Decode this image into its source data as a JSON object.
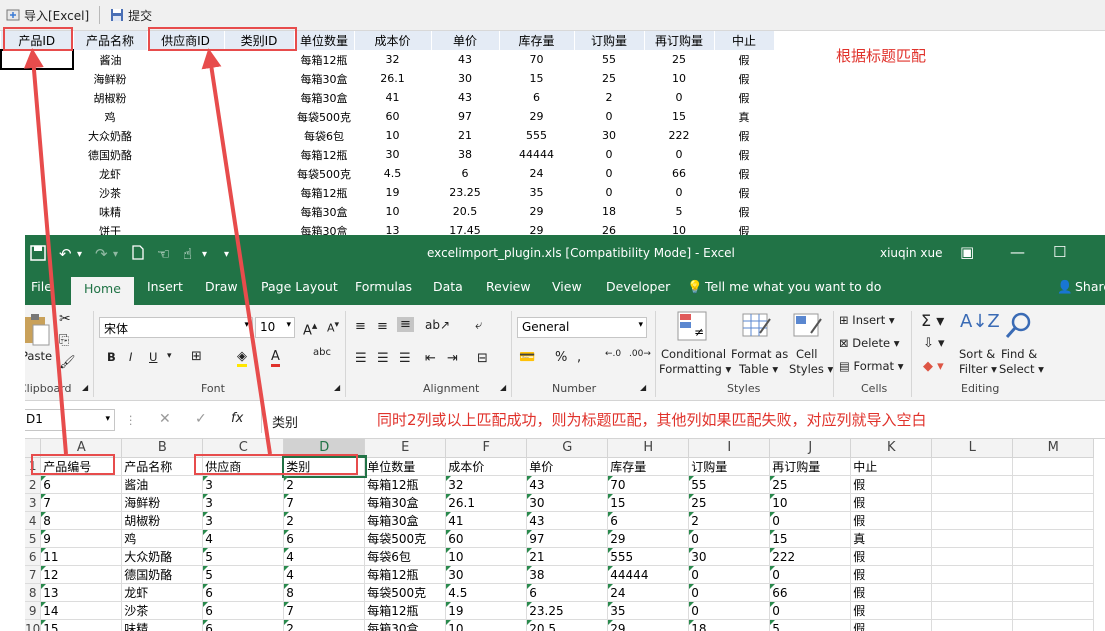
{
  "toolbar": {
    "import_label": "导入[Excel]",
    "submit_label": "提交"
  },
  "top_grid": {
    "headers": [
      "产品ID",
      "产品名称",
      "供应商ID",
      "类别ID",
      "单位数量",
      "成本价",
      "单价",
      "库存量",
      "订购量",
      "再订购量",
      "中止"
    ],
    "rows": [
      [
        "",
        "酱油",
        "",
        "",
        "每箱12瓶",
        "32",
        "43",
        "70",
        "55",
        "25",
        "假"
      ],
      [
        "",
        "海鲜粉",
        "",
        "",
        "每箱30盒",
        "26.1",
        "30",
        "15",
        "25",
        "10",
        "假"
      ],
      [
        "",
        "胡椒粉",
        "",
        "",
        "每箱30盒",
        "41",
        "43",
        "6",
        "2",
        "0",
        "假"
      ],
      [
        "",
        "鸡",
        "",
        "",
        "每袋500克",
        "60",
        "97",
        "29",
        "0",
        "15",
        "真"
      ],
      [
        "",
        "大众奶酪",
        "",
        "",
        "每袋6包",
        "10",
        "21",
        "555",
        "30",
        "222",
        "假"
      ],
      [
        "",
        "德国奶酪",
        "",
        "",
        "每箱12瓶",
        "30",
        "38",
        "44444",
        "0",
        "0",
        "假"
      ],
      [
        "",
        "龙虾",
        "",
        "",
        "每袋500克",
        "4.5",
        "6",
        "24",
        "0",
        "66",
        "假"
      ],
      [
        "",
        "沙茶",
        "",
        "",
        "每箱12瓶",
        "19",
        "23.25",
        "35",
        "0",
        "0",
        "假"
      ],
      [
        "",
        "味精",
        "",
        "",
        "每箱30盒",
        "10",
        "20.5",
        "29",
        "18",
        "5",
        "假"
      ],
      [
        "",
        "饼干",
        "",
        "",
        "每箱30盒",
        "13",
        "17.45",
        "29",
        "26",
        "10",
        "假"
      ]
    ]
  },
  "annotations": {
    "title_match": "根据标题匹配",
    "rule": "同时2列或以上匹配成功，则为标题匹配，其他列如果匹配失败，对应列就导入空白"
  },
  "excel": {
    "doc_title": "excelimport_plugin.xls  [Compatibility Mode] - Excel",
    "user": "xiuqin xue",
    "tabs": [
      "File",
      "Home",
      "Insert",
      "Draw",
      "Page Layout",
      "Formulas",
      "Data",
      "Review",
      "View",
      "Developer"
    ],
    "tell_me": "Tell me what you want to do",
    "share": "Share",
    "font_name": "宋体",
    "font_size": "10",
    "number_format": "General",
    "groups": {
      "clipboard": "Clipboard",
      "font": "Font",
      "alignment": "Alignment",
      "number": "Number",
      "styles": "Styles",
      "cells": "Cells",
      "editing": "Editing"
    },
    "buttons": {
      "paste": "Paste",
      "conditional": "Conditional",
      "formatting": "Formatting",
      "format_as": "Format as",
      "table": "Table",
      "cell": "Cell",
      "styles": "Styles",
      "insert": "Insert",
      "delete": "Delete",
      "format": "Format",
      "sort": "Sort &",
      "filter": "Filter",
      "find": "Find &",
      "select": "Select"
    },
    "name_box": "D1",
    "formula": "类别",
    "fx": "fx",
    "columns": [
      "A",
      "B",
      "C",
      "D",
      "E",
      "F",
      "G",
      "H",
      "I",
      "J",
      "K",
      "L",
      "M"
    ],
    "row_numbers": [
      "1",
      "2",
      "3",
      "4",
      "5",
      "6",
      "7",
      "8",
      "9",
      "10"
    ],
    "rows": [
      [
        "产品编号",
        "产品名称",
        "供应商",
        "类别",
        "单位数量",
        "成本价",
        "单价",
        "库存量",
        "订购量",
        "再订购量",
        "中止"
      ],
      [
        "6",
        "酱油",
        "3",
        "2",
        "每箱12瓶",
        "32",
        "43",
        "70",
        "55",
        "25",
        "假"
      ],
      [
        "7",
        "海鲜粉",
        "3",
        "7",
        "每箱30盒",
        "26.1",
        "30",
        "15",
        "25",
        "10",
        "假"
      ],
      [
        "8",
        "胡椒粉",
        "3",
        "2",
        "每箱30盒",
        "41",
        "43",
        "6",
        "2",
        "0",
        "假"
      ],
      [
        "9",
        "鸡",
        "4",
        "6",
        "每袋500克",
        "60",
        "97",
        "29",
        "0",
        "15",
        "真"
      ],
      [
        "11",
        "大众奶酪",
        "5",
        "4",
        "每袋6包",
        "10",
        "21",
        "555",
        "30",
        "222",
        "假"
      ],
      [
        "12",
        "德国奶酪",
        "5",
        "4",
        "每箱12瓶",
        "30",
        "38",
        "44444",
        "0",
        "0",
        "假"
      ],
      [
        "13",
        "龙虾",
        "6",
        "8",
        "每袋500克",
        "4.5",
        "6",
        "24",
        "0",
        "66",
        "假"
      ],
      [
        "14",
        "沙茶",
        "6",
        "7",
        "每箱12瓶",
        "19",
        "23.25",
        "35",
        "0",
        "0",
        "假"
      ],
      [
        "15",
        "味精",
        "6",
        "2",
        "每箱30盒",
        "10",
        "20.5",
        "29",
        "18",
        "5",
        "假"
      ]
    ]
  }
}
